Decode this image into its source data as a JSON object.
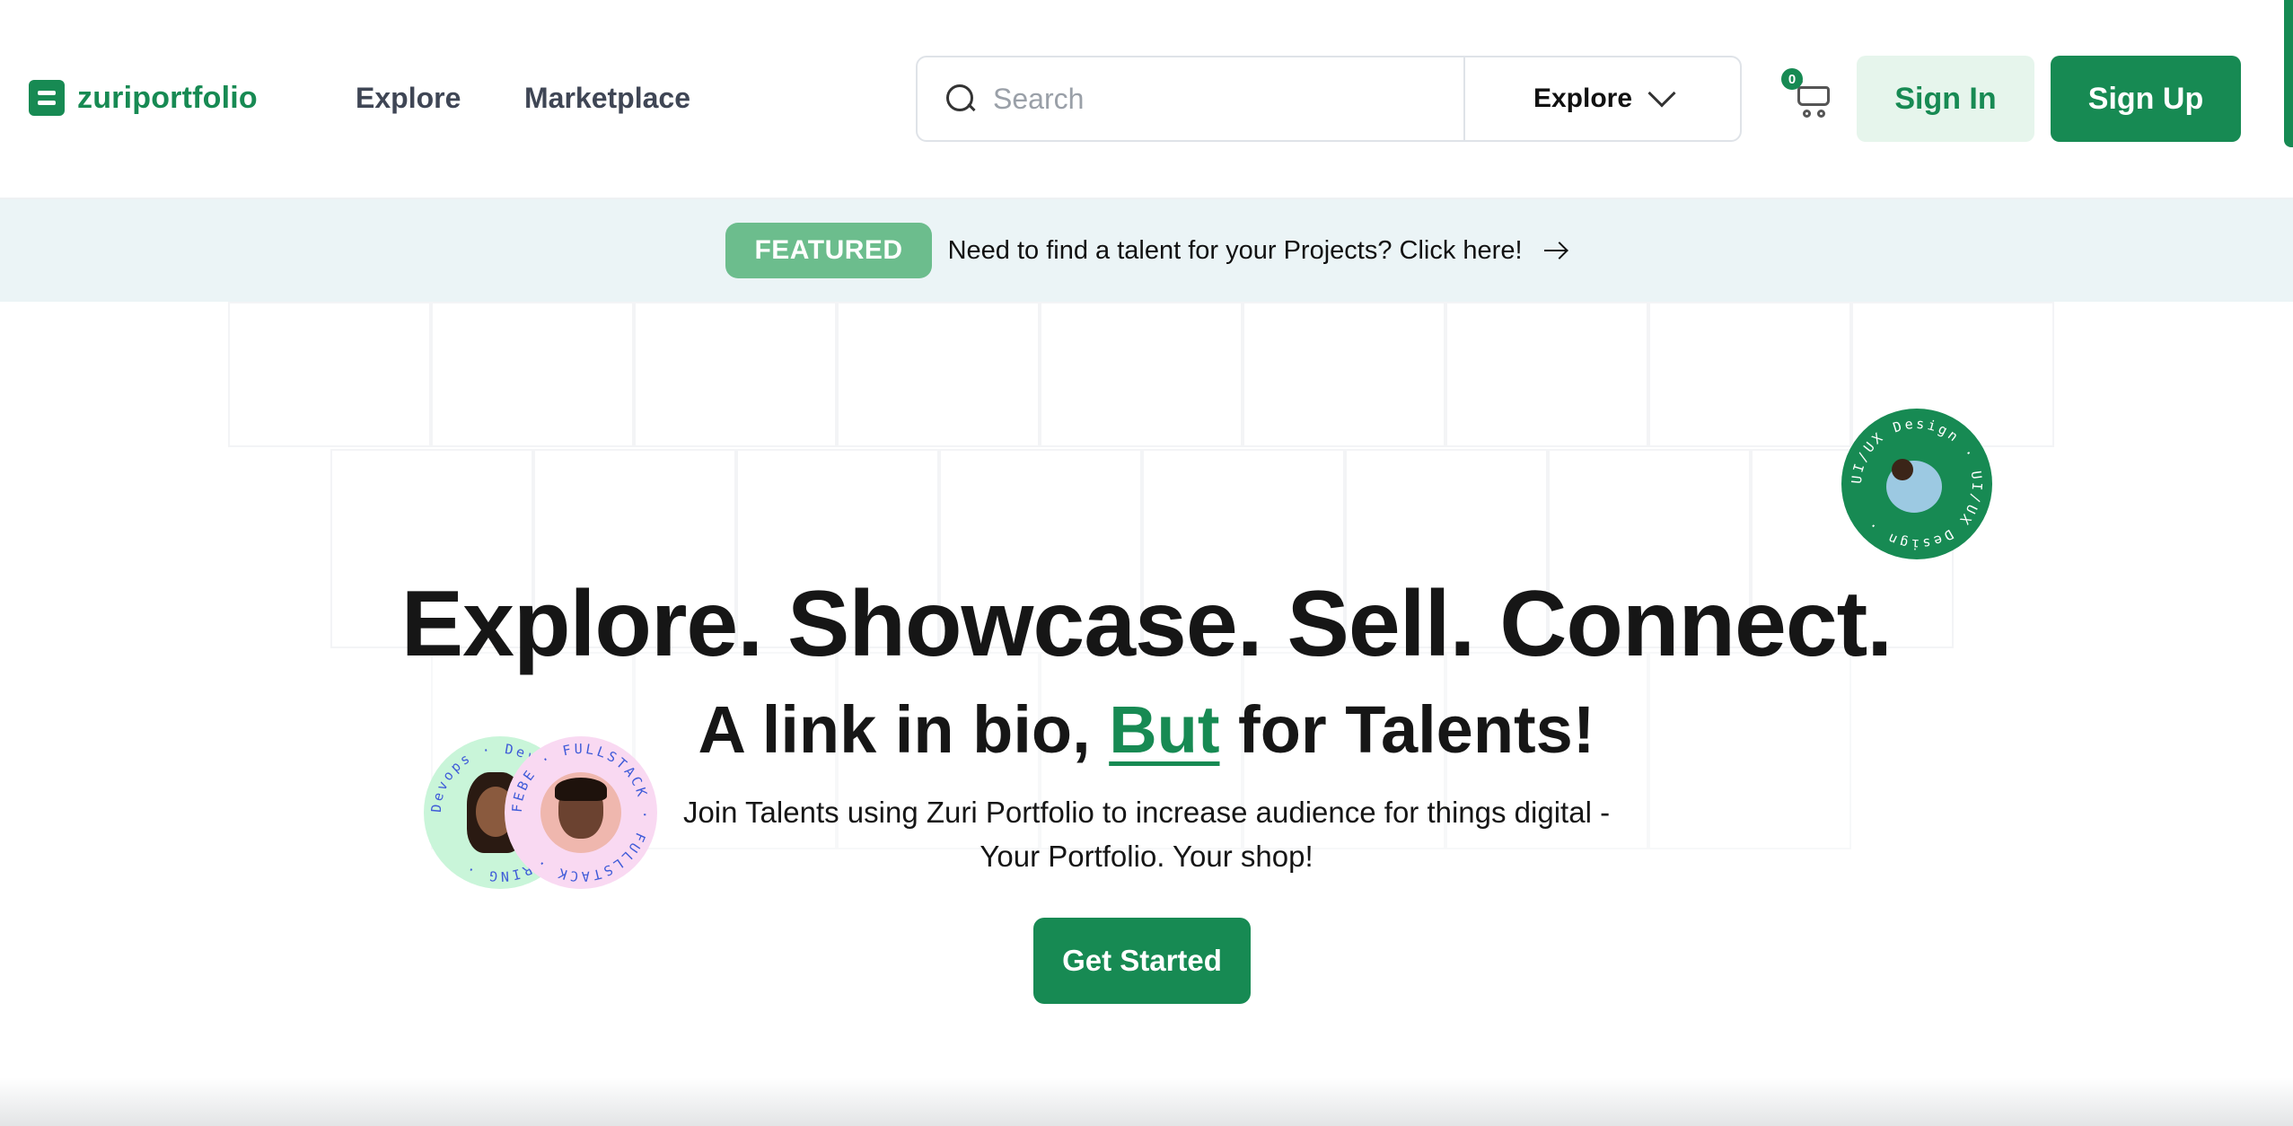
{
  "header": {
    "logo_text": "zuriportfolio",
    "nav": [
      {
        "label": "Explore"
      },
      {
        "label": "Marketplace"
      }
    ],
    "search": {
      "placeholder": "Search",
      "category": "Explore"
    },
    "cart_count": "0",
    "signin_label": "Sign In",
    "signup_label": "Sign Up"
  },
  "banner": {
    "badge": "FEATURED",
    "text": "Need to find a talent for your Projects? Click here!"
  },
  "hero": {
    "headline": "Explore. Showcase. Sell. Connect.",
    "subline_before": "A link in bio, ",
    "subline_accent": "But",
    "subline_after": " for Talents!",
    "description": "Join Talents using Zuri Portfolio to increase audience for things digital - Your Portfolio. Your shop!",
    "cta_label": "Get Started"
  },
  "badges": {
    "uiux": "UI/UX Design · UI/UX Design · ",
    "devops": "Devops · DevOps ENGINEERING · ",
    "febe": "FEBE · FULLSTACK · FULLSTACK · "
  },
  "colors": {
    "brand": "#178a53",
    "brand_light": "#e6f5ec",
    "featured_badge": "#6cbd8d",
    "banner_bg": "#ebf4f6"
  },
  "icons": [
    "logo-icon",
    "search-icon",
    "chevron-down-icon",
    "cart-icon",
    "arrow-right-icon"
  ]
}
